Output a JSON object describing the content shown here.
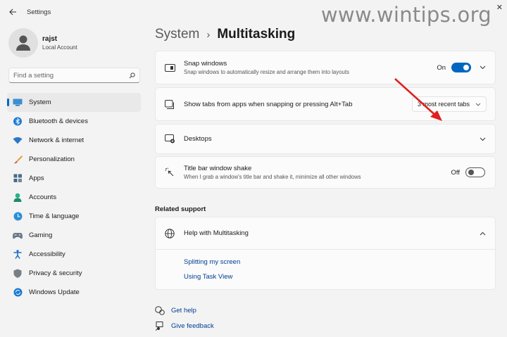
{
  "window": {
    "title": "Settings",
    "watermark": "www.wintips.org"
  },
  "user": {
    "name": "rajst",
    "account_type": "Local Account"
  },
  "search": {
    "placeholder": "Find a setting"
  },
  "nav": {
    "items": [
      {
        "label": "System",
        "icon": "system-icon",
        "active": true
      },
      {
        "label": "Bluetooth & devices",
        "icon": "bluetooth-icon"
      },
      {
        "label": "Network & internet",
        "icon": "wifi-icon"
      },
      {
        "label": "Personalization",
        "icon": "brush-icon"
      },
      {
        "label": "Apps",
        "icon": "apps-icon"
      },
      {
        "label": "Accounts",
        "icon": "person-icon"
      },
      {
        "label": "Time & language",
        "icon": "globe-clock-icon"
      },
      {
        "label": "Gaming",
        "icon": "gamepad-icon"
      },
      {
        "label": "Accessibility",
        "icon": "accessibility-icon"
      },
      {
        "label": "Privacy & security",
        "icon": "shield-icon"
      },
      {
        "label": "Windows Update",
        "icon": "update-icon"
      }
    ]
  },
  "breadcrumb": {
    "parent": "System",
    "separator": "›",
    "current": "Multitasking"
  },
  "settings": {
    "snap": {
      "title": "Snap windows",
      "description": "Snap windows to automatically resize and arrange them into layouts",
      "state": "On"
    },
    "tabs": {
      "title": "Show tabs from apps when snapping or pressing Alt+Tab",
      "selected": "3 most recent tabs"
    },
    "desktops": {
      "title": "Desktops"
    },
    "shake": {
      "title": "Title bar window shake",
      "description": "When I grab a window's title bar and shake it, minimize all other windows",
      "state": "Off"
    }
  },
  "related_support": {
    "heading": "Related support",
    "help_title": "Help with Multitasking",
    "links": [
      "Splitting my screen",
      "Using Task View"
    ]
  },
  "footer": {
    "get_help": "Get help",
    "give_feedback": "Give feedback"
  },
  "colors": {
    "accent": "#0067c0",
    "link": "#003e92",
    "annotation": "#e02020"
  }
}
